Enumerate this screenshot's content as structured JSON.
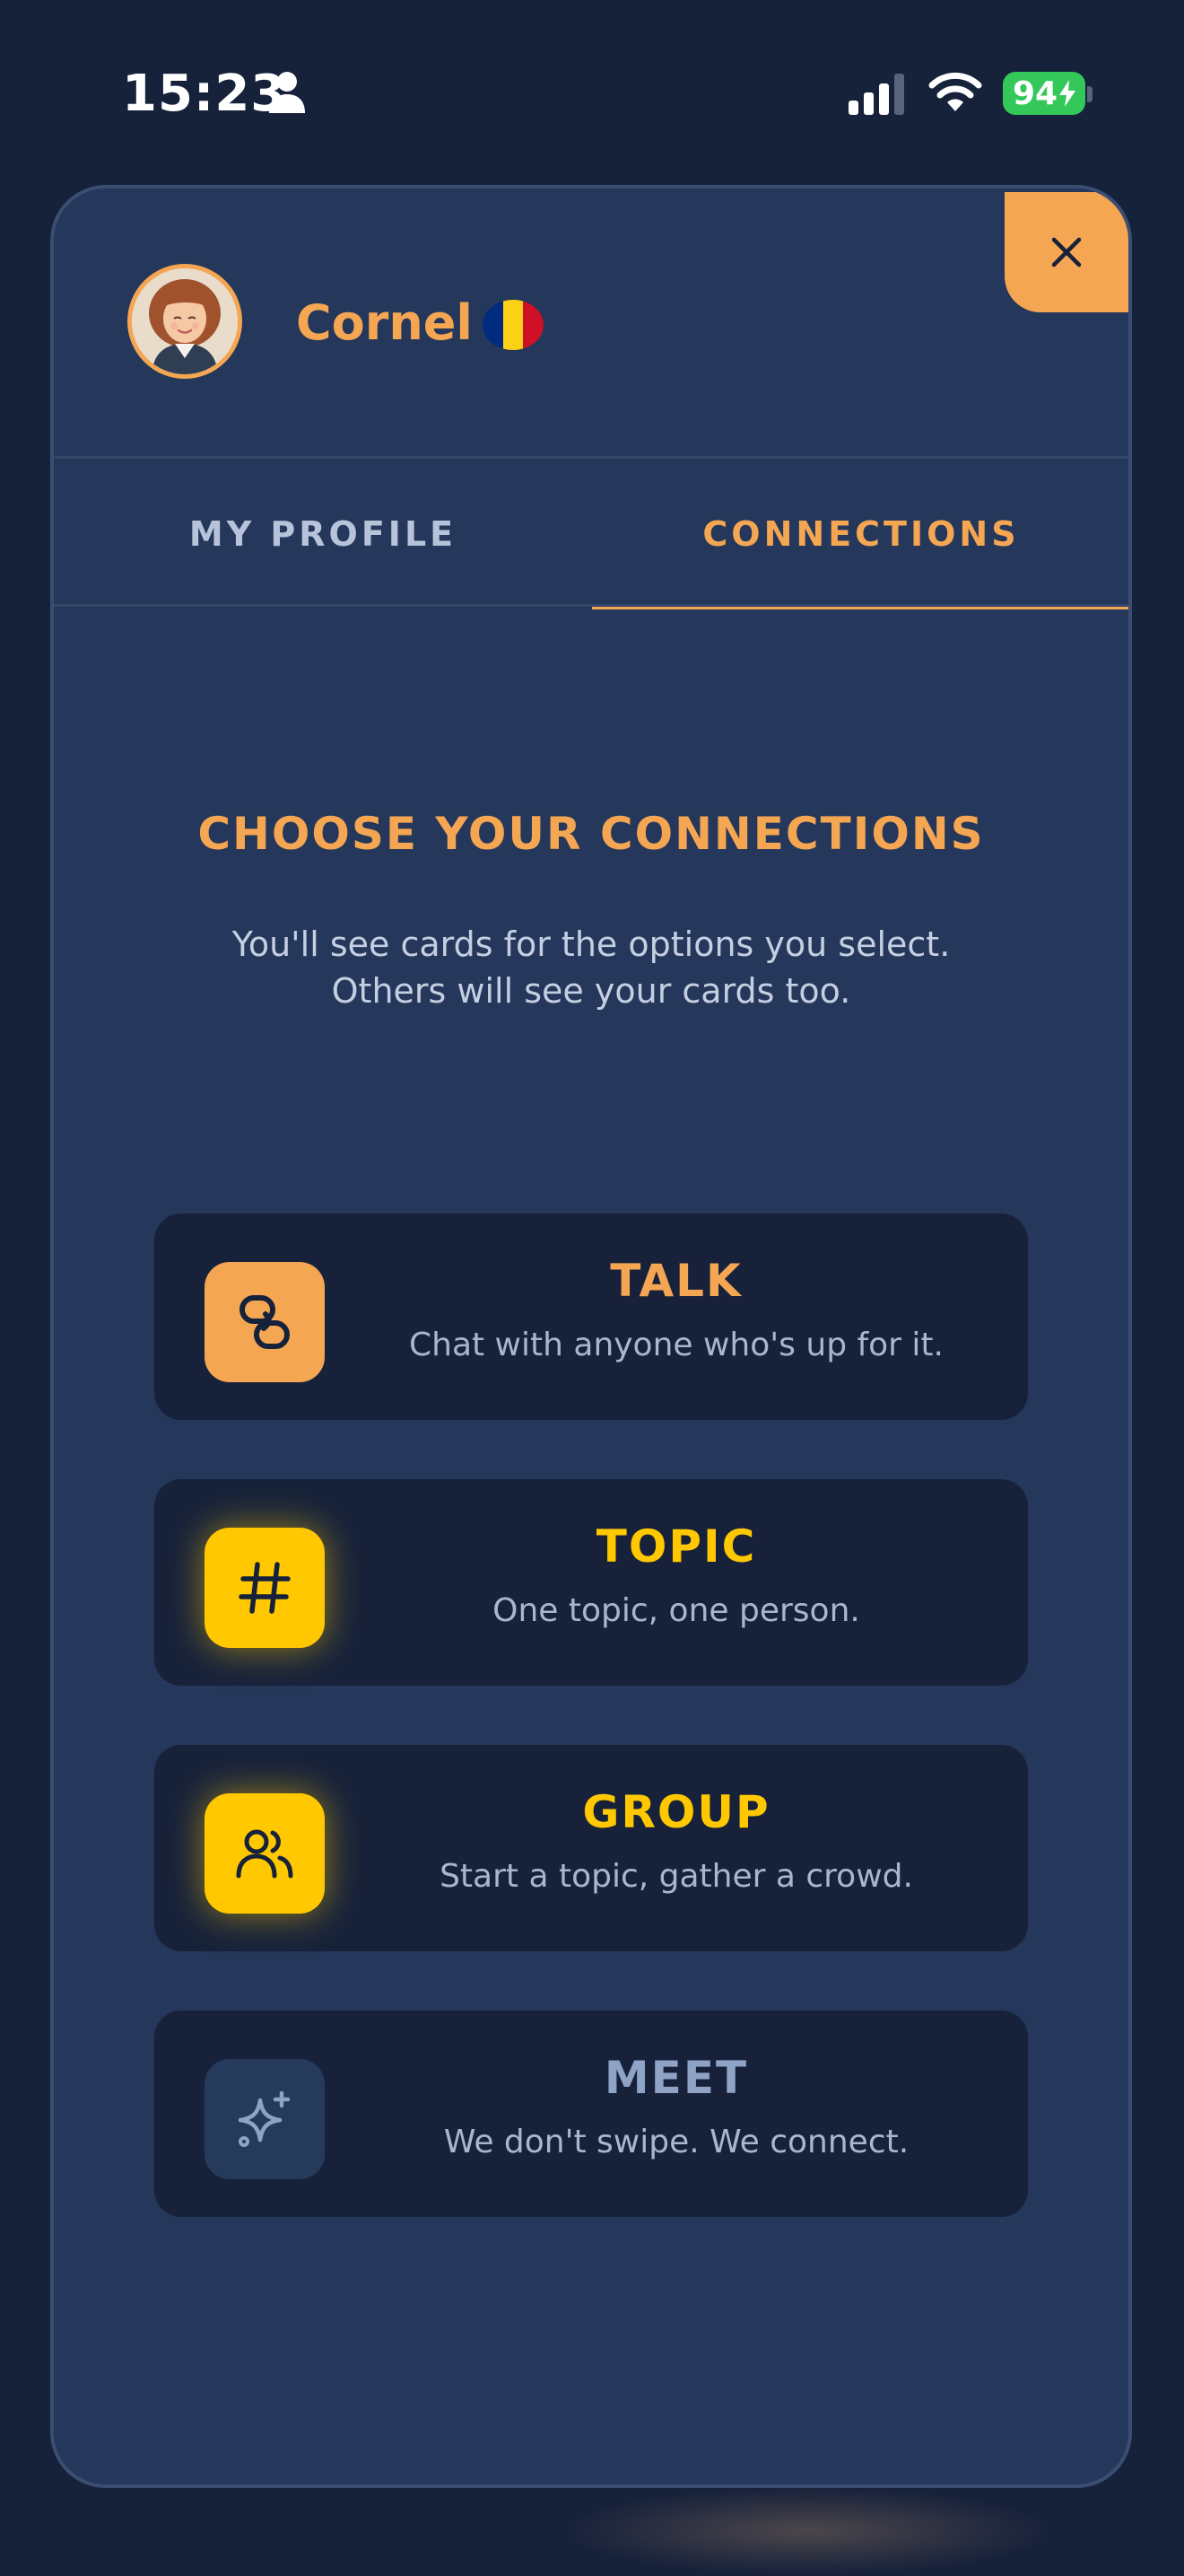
{
  "status_bar": {
    "time": "15:23",
    "battery": "94"
  },
  "user": {
    "name": "Cornel",
    "flag": "romania-flag-icon"
  },
  "tabs": [
    {
      "label": "MY PROFILE",
      "active": false
    },
    {
      "label": "CONNECTIONS",
      "active": true
    }
  ],
  "connections": {
    "title": "CHOOSE YOUR CONNECTIONS",
    "description_line1": "You'll see cards for the options you select.",
    "description_line2": "Others will see your cards too.",
    "options": [
      {
        "title": "TALK",
        "subtitle": "Chat with anyone who's up for it.",
        "icon": "link-icon",
        "color": "#f4a653"
      },
      {
        "title": "TOPIC",
        "subtitle": "One topic, one person.",
        "icon": "hashtag-icon",
        "color": "#ffc800"
      },
      {
        "title": "GROUP",
        "subtitle": "Start a topic, gather a crowd.",
        "icon": "group-icon",
        "color": "#ffc800"
      },
      {
        "title": "MEET",
        "subtitle": "We don't swipe. We connect.",
        "icon": "sparkle-icon",
        "color": "#8ea3c6"
      }
    ]
  },
  "colors": {
    "background": "#16213a",
    "panel": "#25375a",
    "card": "#17223a",
    "accent_orange": "#f4a653",
    "accent_yellow": "#ffc800"
  }
}
